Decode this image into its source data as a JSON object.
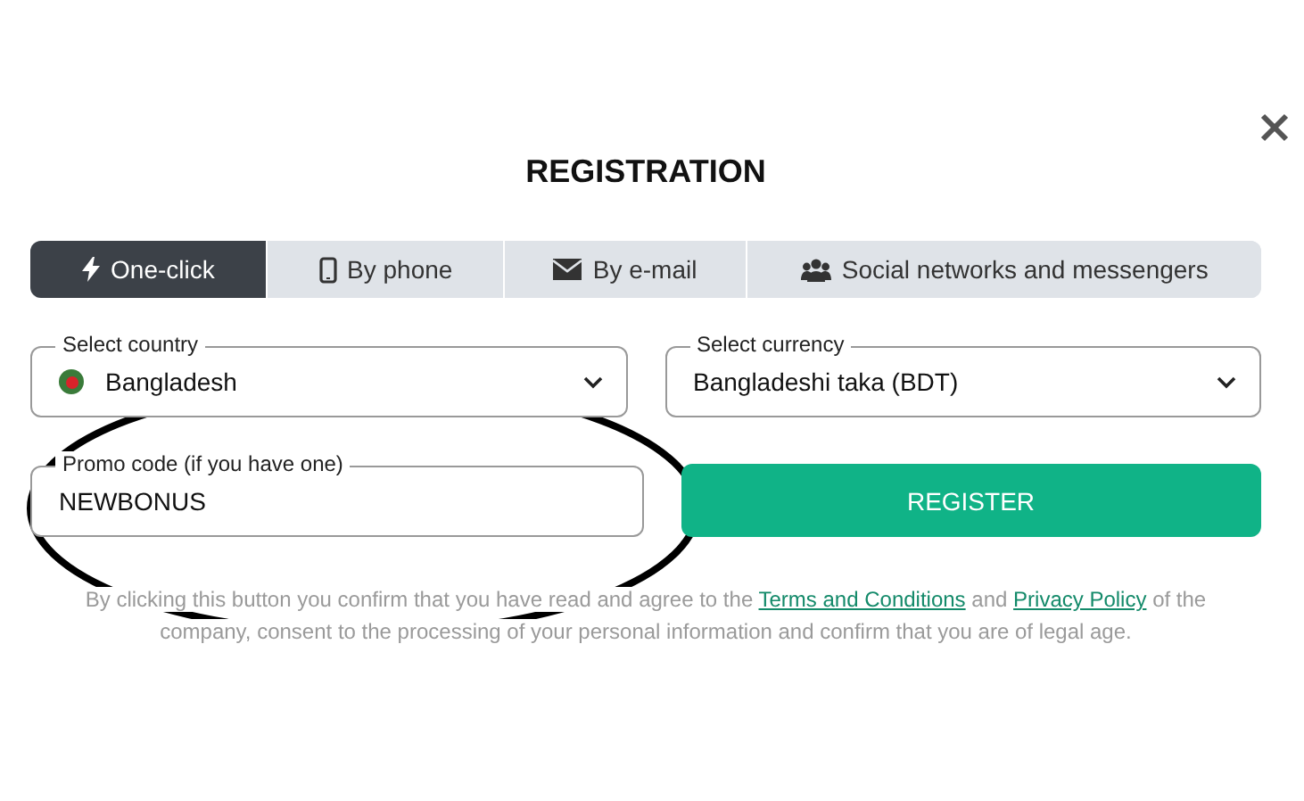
{
  "dialog": {
    "title": "REGISTRATION",
    "tabs": [
      {
        "label": "One-click",
        "selected": true
      },
      {
        "label": "By phone",
        "selected": false
      },
      {
        "label": "By e-mail",
        "selected": false
      },
      {
        "label": "Social networks and messengers",
        "selected": false
      }
    ],
    "country": {
      "label": "Select country",
      "value": "Bangladesh"
    },
    "currency": {
      "label": "Select currency",
      "value": "Bangladeshi taka (BDT)"
    },
    "promo": {
      "label": "Promo code (if you have one)",
      "value": "NEWBONUS"
    },
    "register_button": "REGISTER",
    "disclaimer": {
      "before": "By clicking this button you confirm that you have read and agree to the",
      "link_1": "Terms and Conditions",
      "middle": "and",
      "link_2": "Privacy Policy",
      "after": "of the company, consent to the processing of your personal information and confirm that you are of legal age."
    }
  }
}
